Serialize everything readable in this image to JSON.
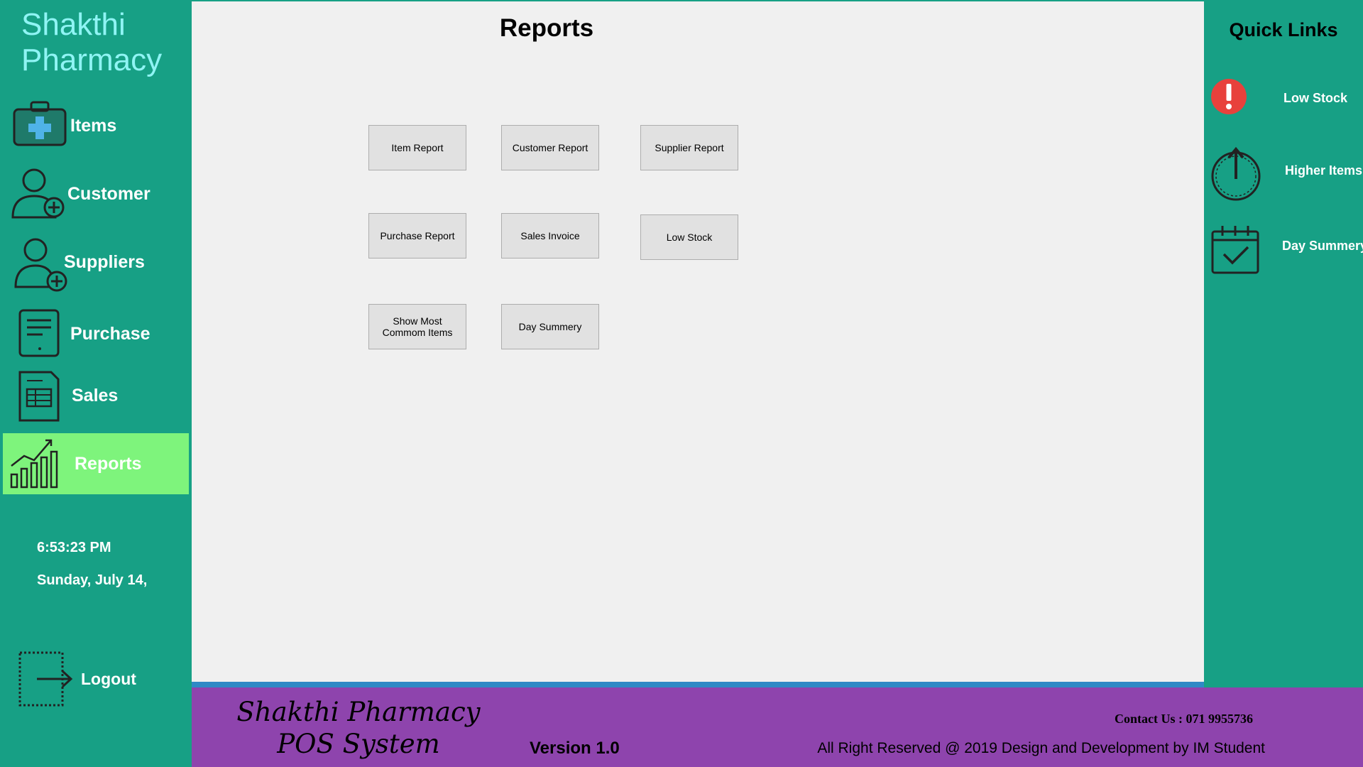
{
  "app": {
    "brand_line1": "Shakthi",
    "brand_line2": "Pharmacy"
  },
  "sidebar": {
    "items": [
      {
        "label": "Items",
        "icon": "medical-kit-icon"
      },
      {
        "label": "Customer",
        "icon": "add-customer-icon"
      },
      {
        "label": "Suppliers",
        "icon": "add-supplier-icon"
      },
      {
        "label": "Purchase",
        "icon": "purchase-document-icon"
      },
      {
        "label": "Sales",
        "icon": "sales-sheet-icon"
      },
      {
        "label": "Reports",
        "icon": "bar-chart-icon",
        "active": true
      }
    ],
    "time": "6:53:23 PM",
    "date": "Sunday, July 14,",
    "logout_label": "Logout"
  },
  "main": {
    "title": "Reports",
    "buttons": {
      "item_report": "Item Report",
      "customer_report": "Customer Report",
      "supplier_report": "Supplier Report",
      "purchase_report": "Purchase Report",
      "sales_invoice": "Sales Invoice",
      "low_stock": "Low Stock",
      "most_common_line1": "Show Most",
      "most_common_line2": "Commom Items",
      "day_summery": "Day Summery"
    }
  },
  "quick_links": {
    "title": "Quick Links",
    "items": [
      {
        "label": "Low Stock",
        "icon": "alert-icon"
      },
      {
        "label": "Higher Items",
        "icon": "power-up-icon"
      },
      {
        "label": "Day Summery",
        "icon": "calendar-check-icon"
      }
    ]
  },
  "footer": {
    "system_line1": "Shakthi Pharmacy",
    "system_line2": "POS System",
    "version": "Version 1.0",
    "contact": "Contact Us : 071 9955736",
    "rights": "All Right Reserved @ 2019 Design and Development by IM Student"
  },
  "colors": {
    "sidebar_bg": "#17a085",
    "active_nav": "#7ef47c",
    "brand_text": "#8ff4f4",
    "footer_bg": "#8e44ad",
    "divider": "#2f89c5",
    "alert_red": "#e8413c"
  }
}
